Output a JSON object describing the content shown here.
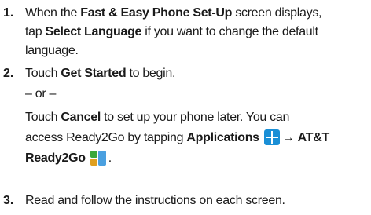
{
  "steps": [
    {
      "number": "1.",
      "lines": [
        {
          "a": "When the ",
          "b": "Fast & Easy Phone Set-Up",
          "c": " screen displays,"
        },
        {
          "a": "tap ",
          "b": "Select Language",
          "c": " if you want to change the default"
        },
        {
          "a": "language."
        }
      ]
    },
    {
      "number": "2.",
      "line1": {
        "a": "Touch ",
        "b": "Get Started",
        "c": " to begin."
      },
      "or_text": "– or –",
      "line3": {
        "a": "Touch ",
        "b": "Cancel",
        "c": " to set up your phone later. You can"
      },
      "line4": {
        "a": "access Ready2Go by tapping ",
        "b": "Applications",
        "arrow": "→",
        "d": "AT&T"
      },
      "line5": {
        "b": "Ready2Go",
        "end": "."
      }
    },
    {
      "number": "3.",
      "text": "Read and follow the instructions on each screen."
    }
  ],
  "icons": {
    "applications": "applications-grid-icon",
    "ready2go": "ready2go-app-icon"
  }
}
